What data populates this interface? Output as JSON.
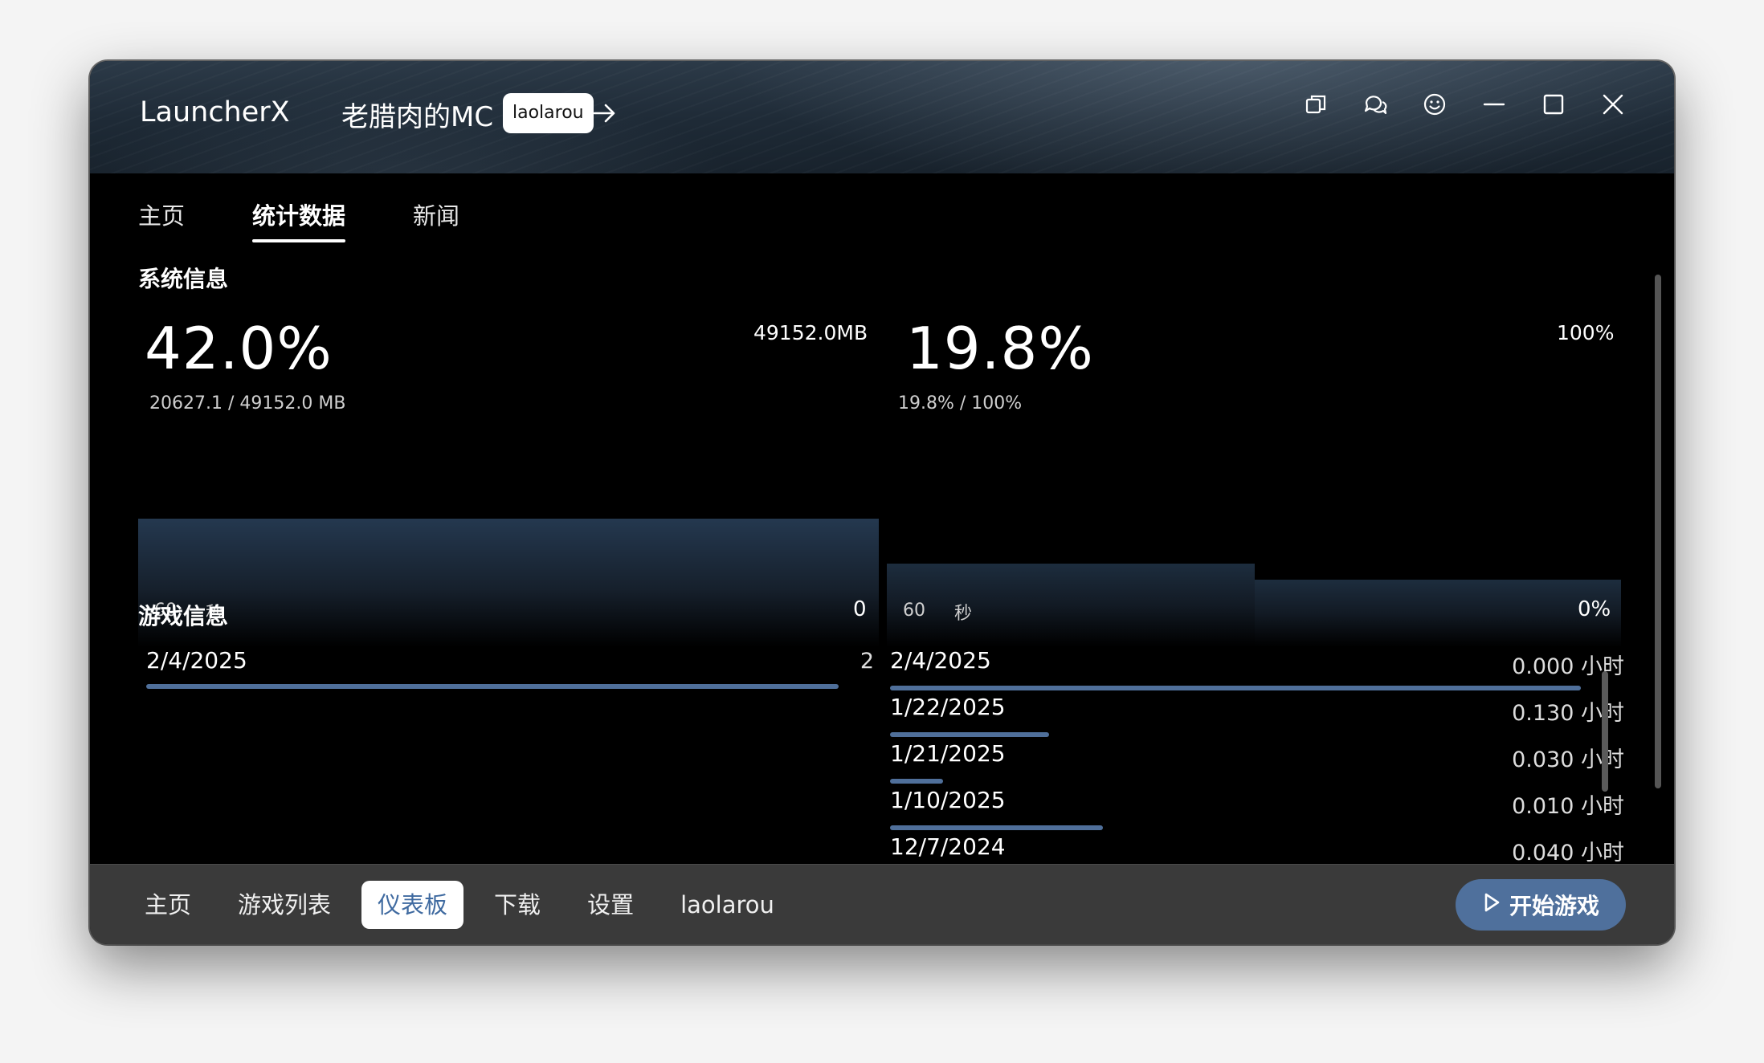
{
  "titlebar": {
    "app_name": "LauncherX",
    "instance_name": "老腊肉的MC",
    "username": "laolarou",
    "icons": [
      "arrow-right-icon",
      "copy-window-icon",
      "chat-icon",
      "smiley-icon",
      "minimize-icon",
      "maximize-icon",
      "close-icon"
    ]
  },
  "tabs": [
    {
      "label": "主页"
    },
    {
      "label": "统计数据"
    },
    {
      "label": "新闻"
    }
  ],
  "system_info": {
    "heading": "系统信息",
    "memory": {
      "percent": "42.0%",
      "detail": "20627.1 / 49152.0 MB",
      "max_label": "49152.0MB",
      "axis_left": "60",
      "axis_unit": "秒",
      "axis_min": "0",
      "usage_fraction": 0.42
    },
    "cpu": {
      "percent": "19.8%",
      "detail": "19.8% / 100%",
      "max_label": "100%",
      "axis_left": "60",
      "axis_unit": "秒",
      "axis_min": "0%",
      "usage_fraction": 0.198
    }
  },
  "game_info": {
    "heading": "游戏信息",
    "launches": {
      "date": "2/4/2025",
      "count": "2"
    },
    "playtime": [
      {
        "date": "2/4/2025",
        "value": "0.000 小时",
        "hours": 0.0
      },
      {
        "date": "1/22/2025",
        "value": "0.130 小时",
        "hours": 0.13
      },
      {
        "date": "1/21/2025",
        "value": "0.030 小时",
        "hours": 0.03
      },
      {
        "date": "1/10/2025",
        "value": "0.010 小时",
        "hours": 0.01
      },
      {
        "date": "12/7/2024",
        "value": "0.040 小时",
        "hours": 0.04
      }
    ]
  },
  "bottom_nav": [
    {
      "label": "主页"
    },
    {
      "label": "游戏列表"
    },
    {
      "label": "仪表板"
    },
    {
      "label": "下载"
    },
    {
      "label": "设置"
    },
    {
      "label": "laolarou"
    }
  ],
  "play_button": {
    "label": "开始游戏"
  },
  "colors": {
    "accent": "#4f709c",
    "bar": "#4f6f9a",
    "bottom_bg": "#3a3a3a"
  }
}
